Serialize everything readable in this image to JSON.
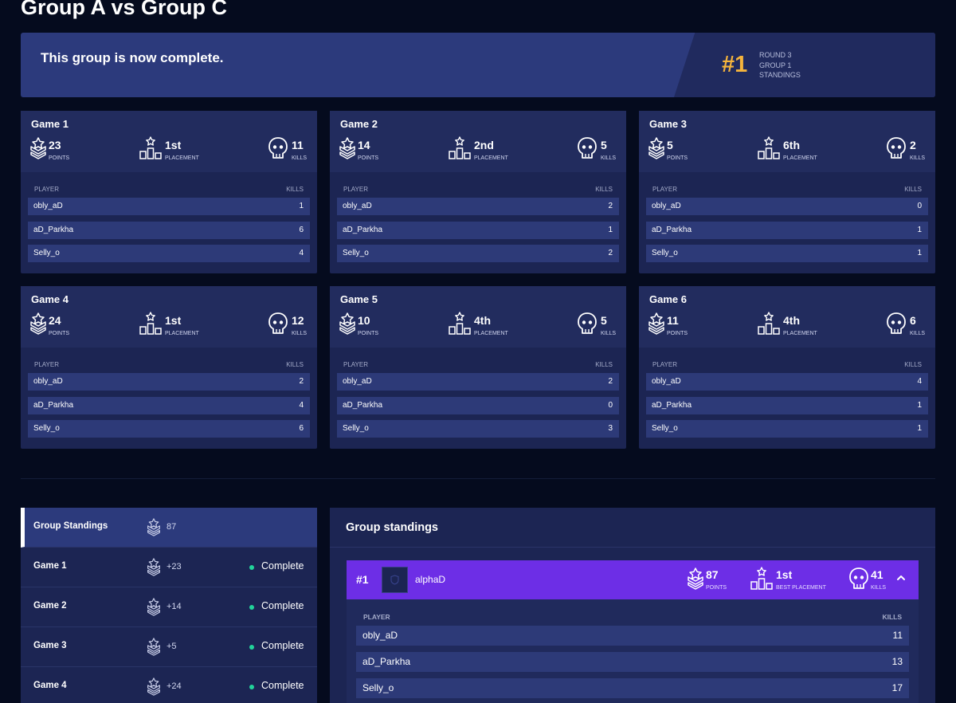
{
  "page": {
    "title": "Group A vs Group C"
  },
  "banner": {
    "message": "This group is now complete.",
    "rank": "#1",
    "meta": [
      "ROUND 3",
      "GROUP 1",
      "STANDINGS"
    ]
  },
  "labels": {
    "points": "POINTS",
    "placement": "PLACEMENT",
    "kills": "KILLS",
    "player": "PLAYER",
    "kills_col": "KILLS",
    "best_placement": "BEST PLACEMENT"
  },
  "games": [
    {
      "title": "Game 1",
      "points": "23",
      "placement": "1st",
      "kills": "11",
      "players": [
        {
          "name": "obly_aD",
          "kills": "1"
        },
        {
          "name": "aD_Parkha",
          "kills": "6"
        },
        {
          "name": "Selly_o",
          "kills": "4"
        }
      ]
    },
    {
      "title": "Game 2",
      "points": "14",
      "placement": "2nd",
      "kills": "5",
      "players": [
        {
          "name": "obly_aD",
          "kills": "2"
        },
        {
          "name": "aD_Parkha",
          "kills": "1"
        },
        {
          "name": "Selly_o",
          "kills": "2"
        }
      ]
    },
    {
      "title": "Game 3",
      "points": "5",
      "placement": "6th",
      "kills": "2",
      "players": [
        {
          "name": "obly_aD",
          "kills": "0"
        },
        {
          "name": "aD_Parkha",
          "kills": "1"
        },
        {
          "name": "Selly_o",
          "kills": "1"
        }
      ]
    },
    {
      "title": "Game 4",
      "points": "24",
      "placement": "1st",
      "kills": "12",
      "players": [
        {
          "name": "obly_aD",
          "kills": "2"
        },
        {
          "name": "aD_Parkha",
          "kills": "4"
        },
        {
          "name": "Selly_o",
          "kills": "6"
        }
      ]
    },
    {
      "title": "Game 5",
      "points": "10",
      "placement": "4th",
      "kills": "5",
      "players": [
        {
          "name": "obly_aD",
          "kills": "2"
        },
        {
          "name": "aD_Parkha",
          "kills": "0"
        },
        {
          "name": "Selly_o",
          "kills": "3"
        }
      ]
    },
    {
      "title": "Game 6",
      "points": "11",
      "placement": "4th",
      "kills": "6",
      "players": [
        {
          "name": "obly_aD",
          "kills": "4"
        },
        {
          "name": "aD_Parkha",
          "kills": "1"
        },
        {
          "name": "Selly_o",
          "kills": "1"
        }
      ]
    }
  ],
  "sidebar": {
    "items": [
      {
        "label": "Group Standings",
        "points": "87",
        "status": ""
      },
      {
        "label": "Game 1",
        "points": "+23",
        "status": "Complete"
      },
      {
        "label": "Game 2",
        "points": "+14",
        "status": "Complete"
      },
      {
        "label": "Game 3",
        "points": "+5",
        "status": "Complete"
      },
      {
        "label": "Game 4",
        "points": "+24",
        "status": "Complete"
      }
    ]
  },
  "standings": {
    "title": "Group standings",
    "team": {
      "rank": "#1",
      "name": "alphaD",
      "points": "87",
      "best_placement": "1st",
      "kills": "41"
    },
    "players": [
      {
        "name": "obly_aD",
        "kills": "11"
      },
      {
        "name": "aD_Parkha",
        "kills": "13"
      },
      {
        "name": "Selly_o",
        "kills": "17"
      }
    ]
  },
  "colors": {
    "background": "#050b1e",
    "card": "#1c2553",
    "row": "#2d3a78",
    "accent_gold": "#f5b43c",
    "team_bar": "#6d2ee6",
    "status_green": "#22d39a"
  }
}
